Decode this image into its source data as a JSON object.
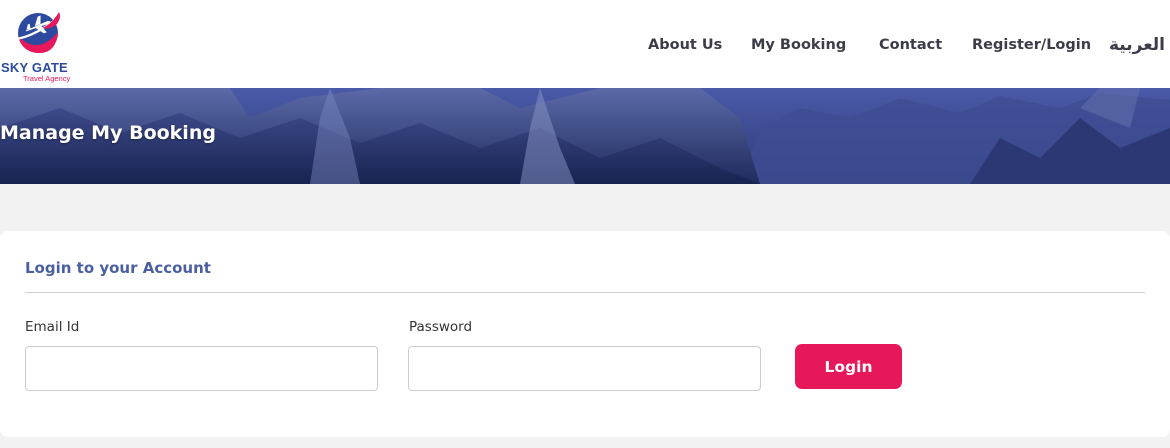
{
  "brand": {
    "name": "SKY GATE",
    "tagline": "Travel Agency",
    "colors": {
      "primary": "#2b4aa0",
      "accent": "#e8185a"
    },
    "logo_icon": "airplane-globe-icon"
  },
  "nav": {
    "items": [
      {
        "label": "About Us"
      },
      {
        "label": "My Booking"
      },
      {
        "label": "Contact"
      },
      {
        "label": "Register/Login"
      },
      {
        "label": "العربية"
      }
    ]
  },
  "banner": {
    "title": "Manage My Booking"
  },
  "login_card": {
    "title": "Login to your Account",
    "email": {
      "label": "Email Id",
      "value": "",
      "placeholder": ""
    },
    "password": {
      "label": "Password",
      "value": "",
      "placeholder": ""
    },
    "submit_label": "Login",
    "button_color": "#e6185a"
  }
}
